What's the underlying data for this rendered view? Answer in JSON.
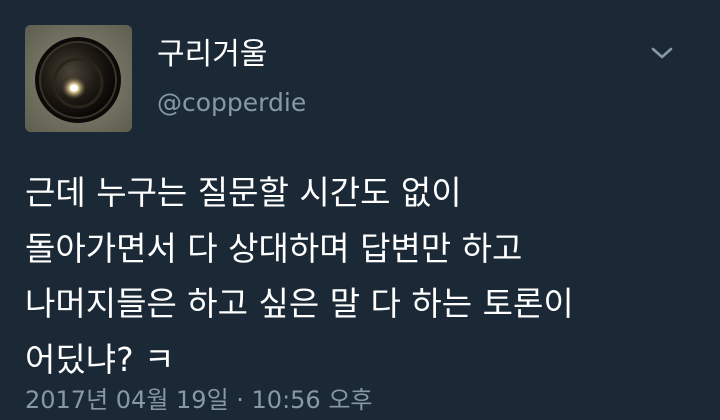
{
  "author": {
    "display_name": "구리거울",
    "handle": "@copperdie",
    "avatar_icon": "copper-mirror-avatar"
  },
  "menu": {
    "icon": "chevron-down-icon"
  },
  "tweet": {
    "lines": [
      "근데 누구는 질문할 시간도 없이",
      "돌아가면서 다 상대하며 답변만 하고",
      "나머지들은 하고 싶은 말 다 하는 토론이",
      "어딨냐? ㅋ"
    ],
    "timestamp": "2017년 04월 19일 · 10:56 오후"
  },
  "colors": {
    "background": "#1b2836",
    "text_primary": "#ffffff",
    "text_secondary": "#8899a6"
  }
}
